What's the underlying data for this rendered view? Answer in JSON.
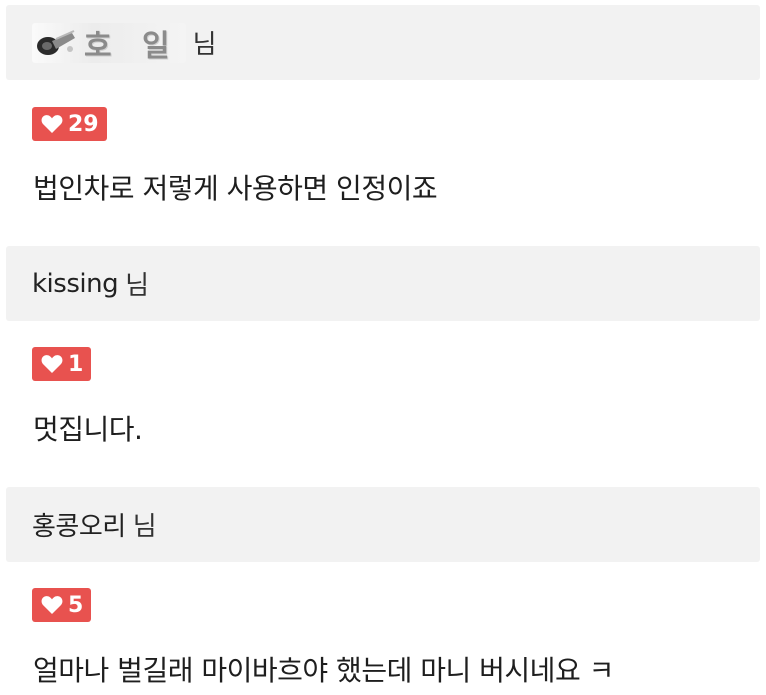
{
  "comments": [
    {
      "author": "호 일",
      "author_suffix": "님",
      "author_is_image": true,
      "likes": "29",
      "text": "법인차로 저렇게 사용하면 인정이죠"
    },
    {
      "author": "kissing",
      "author_suffix": "님",
      "likes": "1",
      "text": "멋집니다."
    },
    {
      "author": "홍콩오리",
      "author_suffix": "님",
      "likes": "5",
      "text": "얼마나 벌길래 마이바흐야 했는데 마니 버시네요 ㅋ"
    }
  ],
  "colors": {
    "author_bar_bg": "#f2f2f2",
    "like_badge_bg": "#e8524f",
    "like_badge_text": "#ffffff"
  },
  "icons": {
    "like": "heart-icon",
    "nick_emblem": "cannon-icon"
  }
}
